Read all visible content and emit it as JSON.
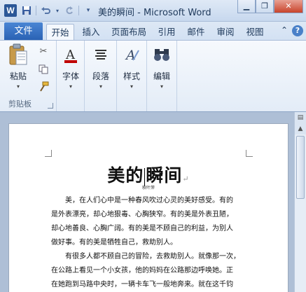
{
  "window": {
    "title": "美的瞬间 - Microsoft Word",
    "app_icon": "W",
    "controls": [
      "minimize-icon",
      "restore-icon",
      "close-icon"
    ]
  },
  "qat": [
    "save-icon",
    "undo-icon",
    "redo-icon",
    "customize-qat-icon"
  ],
  "tabs": {
    "file": "文件",
    "items": [
      "开始",
      "插入",
      "页面布局",
      "引用",
      "邮件",
      "审阅",
      "视图"
    ],
    "active": "开始"
  },
  "ribbon": {
    "clipboard": {
      "paste": "粘贴",
      "group_label": "剪贴板"
    },
    "font": {
      "label": "字体"
    },
    "paragraph": {
      "label": "段落"
    },
    "styles": {
      "label": "样式"
    },
    "editing": {
      "label": "编辑"
    },
    "colors": {
      "accent": "#2a62b4",
      "font_red": "#c00000"
    }
  },
  "document": {
    "title_before_caret": "美的",
    "title_after_caret": "瞬间",
    "paragraph_mark": "↵",
    "author": "秋叶萍",
    "lines": [
      "美，在人们心中是一种春风吹过心灵的美好感受。有的",
      "是外表漂亮，却心地狠毒、心胸狭窄。有的美是外表丑陋，",
      "却心地善良、心胸广阔。有的美是不顾自己的利益，为别人",
      "做好事。有的美是牺牲自己，救助别人。",
      "有很多人都不顾自己的冒险，去救助别人。就像那一次，",
      "在公路上看见一个小女孩，他的妈妈在公路那边呼唤她。正",
      "在她跑到马路中央时，一辆卡车飞一般地奔来。就在这千钧"
    ]
  }
}
